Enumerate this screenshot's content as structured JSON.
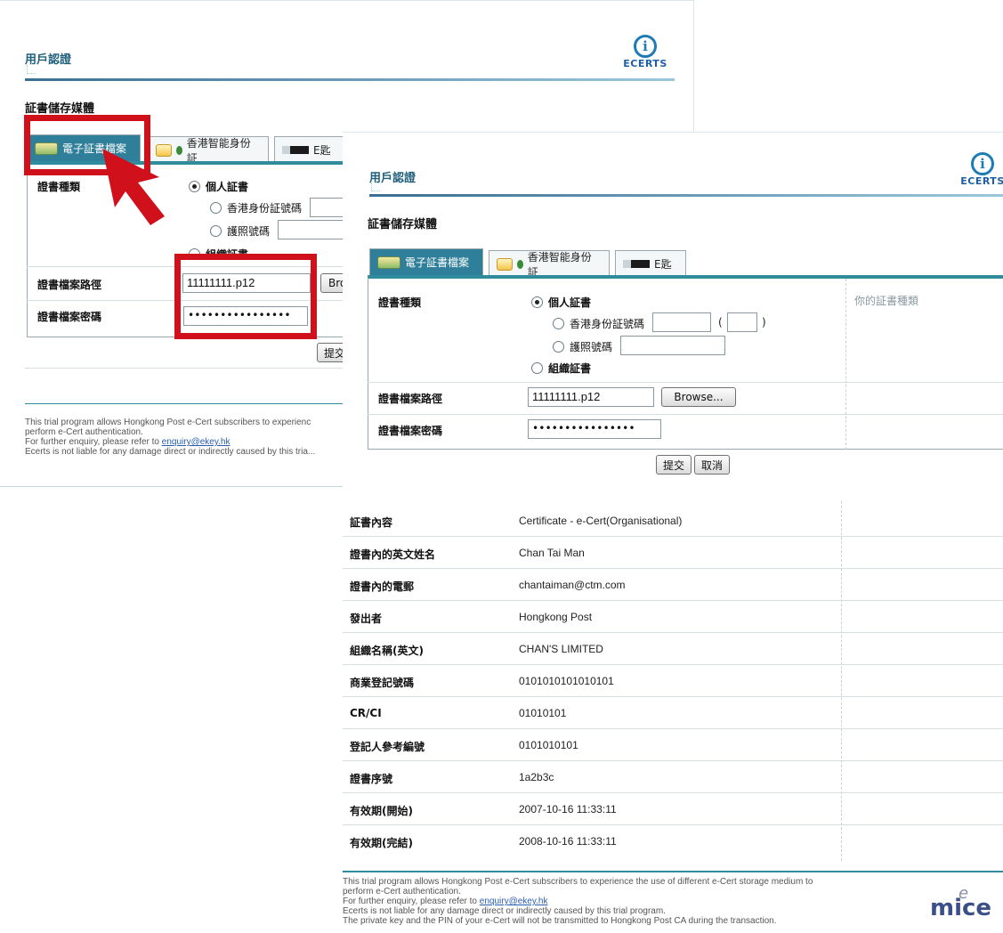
{
  "header": {
    "title": "用戶認證",
    "logo_text": "ECERTS",
    "logo_icon": "info-icon"
  },
  "storage": {
    "title": "証書儲存媒體"
  },
  "tabs": [
    {
      "label": "電子証書檔案",
      "icon": "certificate-file-icon"
    },
    {
      "label": "香港智能身份証",
      "icon": "smart-id-card-icon"
    },
    {
      "label": "E匙",
      "icon": "usb-key-icon"
    }
  ],
  "form": {
    "cert_type_label": "證書種類",
    "personal_cert": "個人証書",
    "hkid_label": "香港身份証號碼",
    "passport_label": "護照號碼",
    "org_cert": "組織証書",
    "path_label": "證書檔案路徑",
    "path_value": "11111111.p12",
    "browse_label": "Browse...",
    "browse_cut": "Bro",
    "password_label": "證書檔案密碼",
    "password_value": "••••••••••••••••",
    "hint": "你的証書種類",
    "paren_open": "(",
    "paren_close": ")"
  },
  "actions": {
    "submit": "提交",
    "cancel": "取消"
  },
  "cert_table": [
    {
      "label": "証書內容",
      "value": "Certificate - e-Cert(Organisational)"
    },
    {
      "label": "證書內的英文姓名",
      "value": "Chan Tai Man"
    },
    {
      "label": "證書內的電郵",
      "value": "chantaiman@ctm.com"
    },
    {
      "label": "發出者",
      "value": "Hongkong Post"
    },
    {
      "label": "組織名稱(英文)",
      "value": "CHAN'S LIMITED"
    },
    {
      "label": "商業登記號碼",
      "value": "0101010101010101"
    },
    {
      "label": "CR/CI",
      "value": "01010101"
    },
    {
      "label": "登記人參考編號",
      "value": "0101010101"
    },
    {
      "label": "證書序號",
      "value": "1a2b3c"
    },
    {
      "label": "有效期(開始)",
      "value": "2007-10-16 11:33:11"
    },
    {
      "label": "有效期(完結)",
      "value": "2008-10-16 11:33:11"
    }
  ],
  "footer": {
    "line1": "This trial program allows Hongkong Post e-Cert subscribers to experience the use of different e-Cert storage medium to",
    "line1_cut": "This trial program allows Hongkong Post e-Cert subscribers to experienc",
    "line2": "perform e-Cert authentication.",
    "line3_prefix": "For further enquiry, please refer to ",
    "email": "enquiry@ekey.hk",
    "line4": "Ecerts is not liable for any damage direct or indirectly caused by this trial program.",
    "line4_cut": "Ecerts is not liable for any damage direct or indirectly caused by this tria...",
    "line5": "The private key and the PIN of your e-Cert will not be transmitted to Hongkong Post CA during the transaction."
  },
  "brand": {
    "mice": "mice",
    "mice_mark": "e"
  },
  "colors": {
    "accent": "#2f7f9a",
    "highlight": "#d0111c",
    "link": "#2a5db0"
  }
}
